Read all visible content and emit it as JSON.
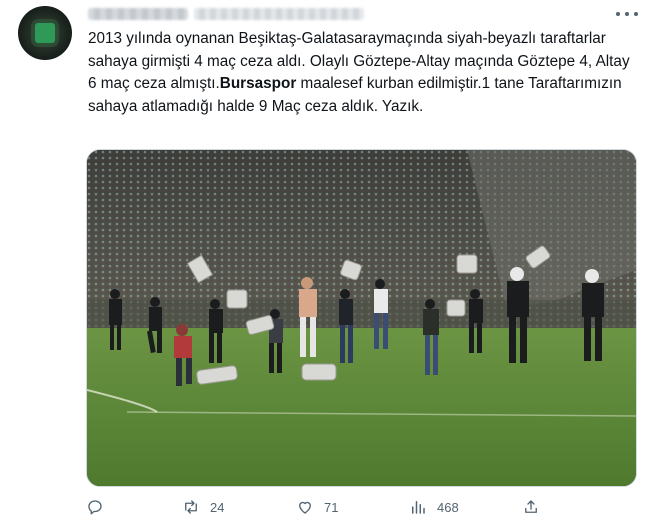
{
  "tweet": {
    "text_part1": "2013 yılında oynanan Beşiktaş-Galatasaraymaçında siyah-beyazlı taraftarlar sahaya girmişti 4 maç ceza aldı. Olaylı Göztepe-Altay maçında Göztepe 4, Altay 6 maç ceza almıştı.",
    "mention": "Bursaspor",
    "text_part2": " maalesef kurban edilmiştir.1 tane Taraftarımızın sahaya atlamadığı halde 9 Maç ceza aldık. Yazık."
  },
  "actions": {
    "reply_count": "",
    "retweet_count": "24",
    "like_count": "71",
    "views_count": "468"
  },
  "colors": {
    "text": "#0f1419",
    "muted": "#536471",
    "border": "#cfd9de",
    "pitch": "#5c8a3a"
  },
  "icons": [
    "more-icon",
    "reply-icon",
    "retweet-icon",
    "like-icon",
    "views-icon",
    "share-icon"
  ]
}
